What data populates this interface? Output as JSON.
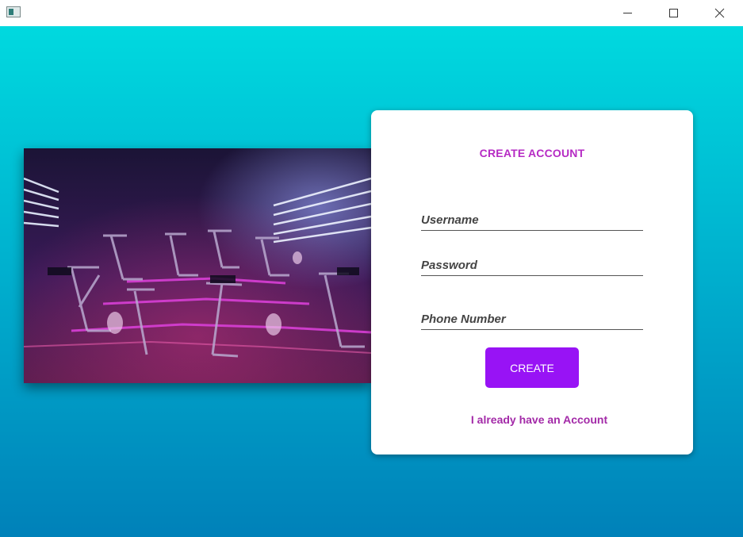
{
  "window": {
    "controls": {
      "minimize_icon": "minimize-icon",
      "maximize_icon": "maximize-icon",
      "close_icon": "close-icon"
    }
  },
  "colors": {
    "gradient_top": "#00d9df",
    "gradient_bottom": "#0081b9",
    "accent_purple": "#9813f5",
    "title_purple": "#b62bc4",
    "link_purple": "#a32aa8"
  },
  "hero_image": {
    "description_icon": "spin-studio-photo"
  },
  "form": {
    "title": "CREATE ACCOUNT",
    "username_placeholder": "Username",
    "password_placeholder": "Password",
    "phone_placeholder": "Phone Number",
    "username_value": "",
    "password_value": "",
    "phone_value": "",
    "create_label": "CREATE",
    "login_link": "I already have an Account"
  }
}
